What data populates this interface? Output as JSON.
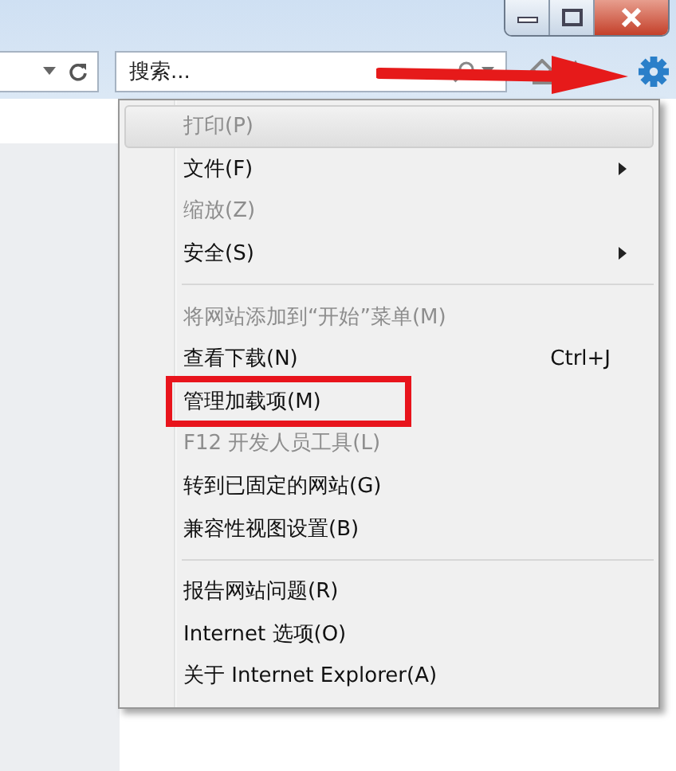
{
  "search": {
    "placeholder": "搜索..."
  },
  "menu": {
    "items": [
      {
        "kind": "item",
        "label": "打印(P)",
        "disabled": true,
        "highlighted": true,
        "submenu": false
      },
      {
        "kind": "item",
        "label": "文件(F)",
        "disabled": false,
        "highlighted": false,
        "submenu": true
      },
      {
        "kind": "item",
        "label": "缩放(Z)",
        "disabled": true,
        "highlighted": false,
        "submenu": false
      },
      {
        "kind": "item",
        "label": "安全(S)",
        "disabled": false,
        "highlighted": false,
        "submenu": true
      },
      {
        "kind": "separator"
      },
      {
        "kind": "item",
        "label": "将网站添加到“开始”菜单(M)",
        "disabled": true,
        "highlighted": false,
        "submenu": false
      },
      {
        "kind": "item",
        "label": "查看下载(N)",
        "disabled": false,
        "highlighted": false,
        "submenu": false,
        "shortcut": "Ctrl+J"
      },
      {
        "kind": "item",
        "label": "管理加载项(M)",
        "disabled": false,
        "highlighted": false,
        "submenu": false,
        "annotated": true
      },
      {
        "kind": "item",
        "label": "F12 开发人员工具(L)",
        "disabled": true,
        "highlighted": false,
        "submenu": false
      },
      {
        "kind": "item",
        "label": "转到已固定的网站(G)",
        "disabled": false,
        "highlighted": false,
        "submenu": false
      },
      {
        "kind": "item",
        "label": "兼容性视图设置(B)",
        "disabled": false,
        "highlighted": false,
        "submenu": false
      },
      {
        "kind": "separator"
      },
      {
        "kind": "item",
        "label": "报告网站问题(R)",
        "disabled": false,
        "highlighted": false,
        "submenu": false
      },
      {
        "kind": "item",
        "label": "Internet 选项(O)",
        "disabled": false,
        "highlighted": false,
        "submenu": false
      },
      {
        "kind": "item",
        "label": "关于 Internet Explorer(A)",
        "disabled": false,
        "highlighted": false,
        "submenu": false
      }
    ]
  }
}
